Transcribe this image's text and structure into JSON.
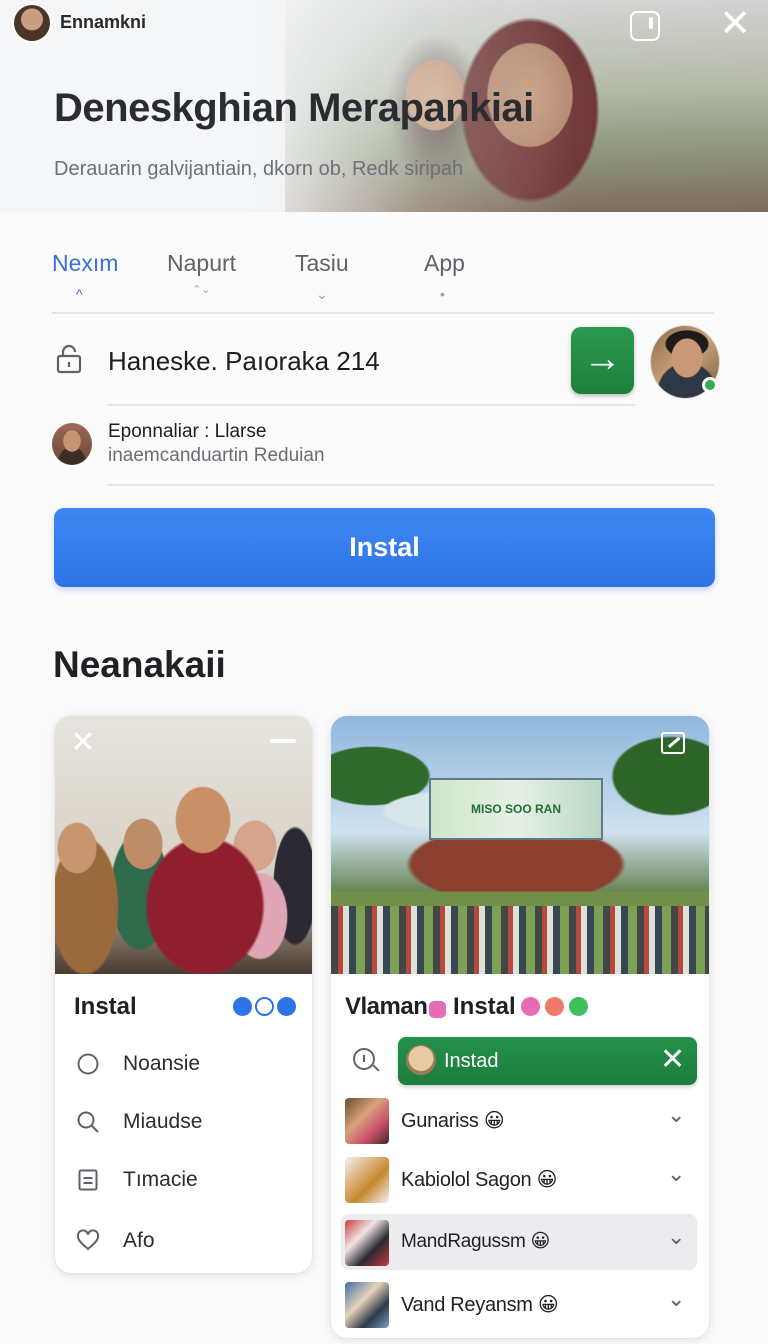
{
  "hero": {
    "brand": "Ennamkni",
    "title": "Deneskghian Merapankiai",
    "subtitle": "Derauarin galvijantiain, dkorn ob, Redk siripah",
    "open_icon": "open-external-icon",
    "close_icon": "close-icon",
    "close_glyph": "✕"
  },
  "tabs": [
    {
      "label": "Nexım",
      "marker": "^",
      "active": true
    },
    {
      "label": "Napurt",
      "marker": "⌃⌄",
      "active": false
    },
    {
      "label": "Tasiu",
      "marker": "⌄",
      "active": false
    },
    {
      "label": "App",
      "marker": "•",
      "active": false
    }
  ],
  "address": {
    "text": "Haneske. Paıoraka 214",
    "go_glyph": "→"
  },
  "account": {
    "name": "Eponnaliar : Llarse",
    "subtitle": "inaemcanduartin Reduian"
  },
  "install_button": {
    "label": "Instal"
  },
  "section": {
    "title": "Neanakaii"
  },
  "card_left": {
    "close_glyph": "✕",
    "title": "Instal",
    "menu": [
      {
        "label": "Noansie",
        "icon": "circle-icon"
      },
      {
        "label": "Miaudse",
        "icon": "search-icon"
      },
      {
        "label": "Tımacie",
        "icon": "document-icon"
      },
      {
        "label": "Afo",
        "icon": "heart-icon"
      }
    ],
    "dot_colors": [
      "#2e74e6",
      "#2e74e6",
      "#2e74e6"
    ]
  },
  "card_right": {
    "banner_text": "MISO SOO RAN",
    "title_prefix": "Vlaman",
    "title": "Instal",
    "dot_colors": [
      "#e86bb5",
      "#f07a6a",
      "#3cc15c"
    ],
    "chip": {
      "label": "Instad",
      "close_glyph": "✕"
    },
    "list": [
      {
        "label": "Gunariss 😀",
        "selected": false
      },
      {
        "label": "Kabiolol Sagon 😀",
        "selected": false
      },
      {
        "label": "MandRagussm 😀",
        "selected": true
      },
      {
        "label": "Vand Reyansm 😀",
        "selected": false
      }
    ],
    "chevron": "⌄"
  },
  "colors": {
    "accent_blue": "#2e74e6",
    "accent_green": "#1f7f3d",
    "tab_active": "#3b6fd8"
  }
}
